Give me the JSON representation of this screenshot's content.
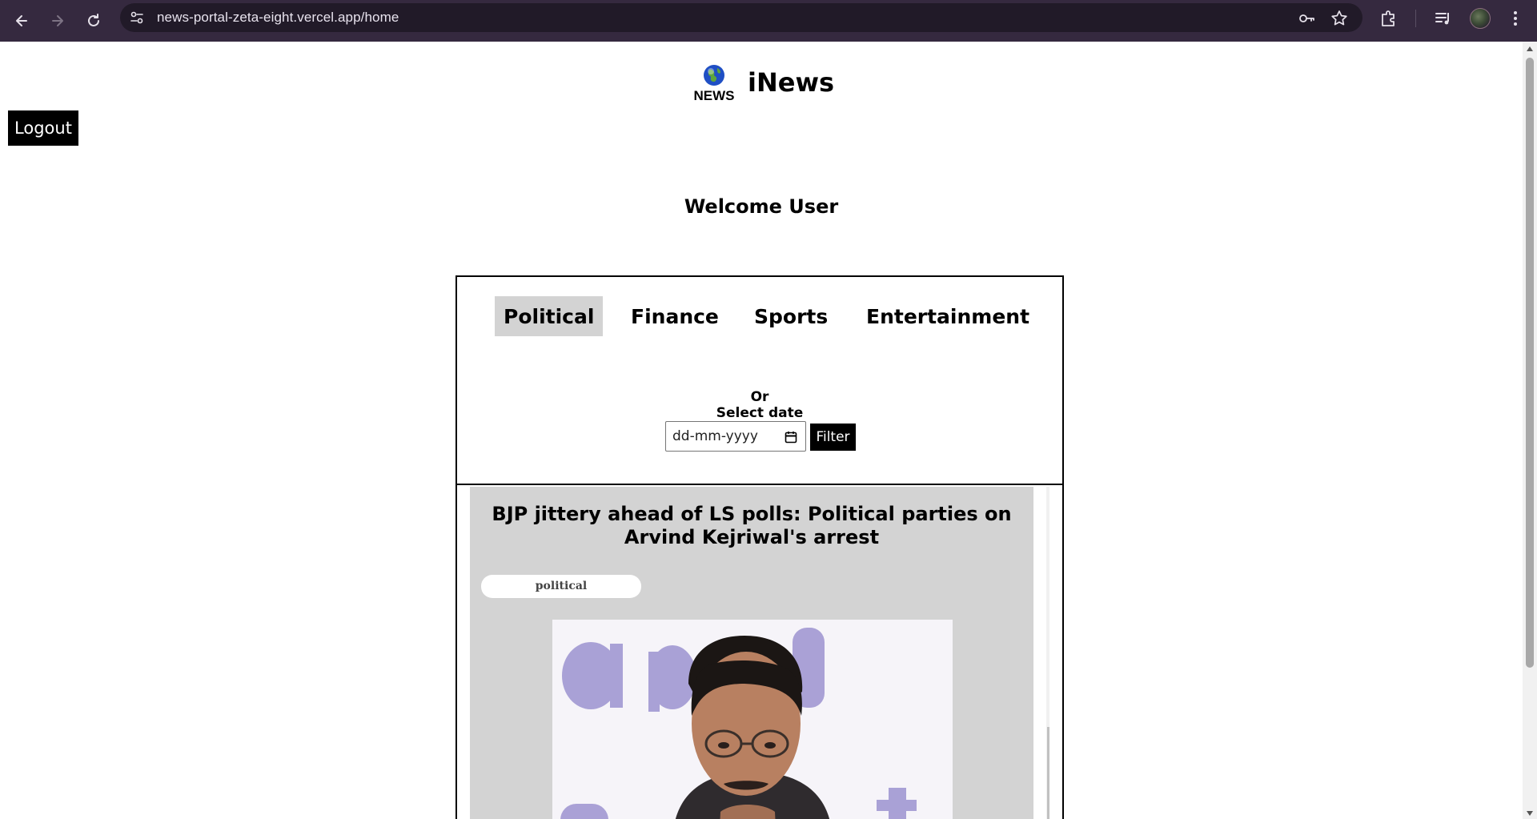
{
  "browser": {
    "url": "news-portal-zeta-eight.vercel.app/home",
    "icons": [
      "back-icon",
      "forward-icon",
      "reload-icon",
      "site-info-icon",
      "key-icon",
      "star-icon",
      "extensions-icon",
      "media-icon",
      "profile-avatar",
      "menu-icon"
    ]
  },
  "header": {
    "logo_word": "NEWS",
    "site_title": "iNews",
    "logout_label": "Logout"
  },
  "welcome": {
    "text": "Welcome User"
  },
  "categories": {
    "tabs": [
      {
        "label": "Political",
        "active": true
      },
      {
        "label": "Finance",
        "active": false
      },
      {
        "label": "Sports",
        "active": false
      },
      {
        "label": "Entertainment",
        "active": false
      }
    ]
  },
  "filter": {
    "or_label": "Or",
    "date_label": "Select date",
    "date_placeholder": "dd-mm-yyyy",
    "button_label": "Filter"
  },
  "feed": {
    "articles": [
      {
        "title": "BJP jittery ahead of LS polls: Political parties on Arvind Kejriwal's arrest",
        "category": "political"
      }
    ]
  },
  "colors": {
    "chrome_bg": "#35293f",
    "omnibox_bg": "#211a28",
    "button_bg": "#000000",
    "active_tab_bg": "#d3d3d3",
    "card_bg": "#d3d3d3"
  }
}
